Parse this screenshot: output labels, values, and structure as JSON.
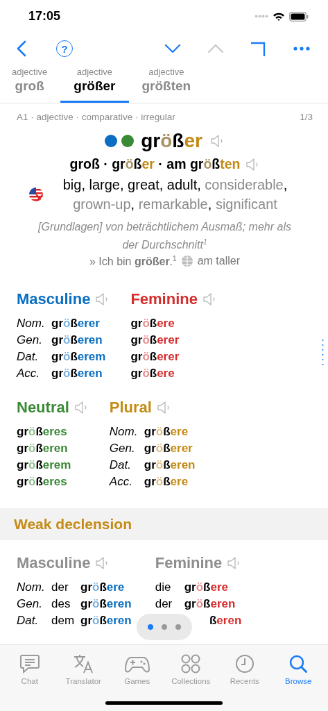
{
  "status_bar": {
    "time": "17:05"
  },
  "nav": {
    "buttons": [
      {
        "kind": "back",
        "disabled": false
      },
      {
        "kind": "help",
        "label": "?",
        "disabled": false
      },
      {
        "kind": "down",
        "disabled": false
      },
      {
        "kind": "up",
        "disabled": true
      },
      {
        "kind": "corner",
        "disabled": false
      },
      {
        "kind": "more",
        "disabled": false
      }
    ]
  },
  "word_tabs": [
    {
      "caption": "adjective",
      "word": "groß",
      "selected": false
    },
    {
      "caption": "adjective",
      "word": "größer",
      "selected": true
    },
    {
      "caption": "adjective",
      "word": "größten",
      "selected": false
    }
  ],
  "entry": {
    "meta": "A1 · adjective · comparative · irregular",
    "position": "1/3",
    "gender_dots": [
      {
        "color": "#0a6fc2"
      },
      {
        "color": "#3a8a35"
      }
    ],
    "headword": [
      "gr",
      "ö",
      "ß",
      "er"
    ],
    "forms": {
      "separator": "·",
      "words": [
        [
          "groß"
        ],
        [
          "gr",
          "ö",
          "ß",
          "er"
        ],
        [
          "am gr",
          "ö",
          "ß",
          "ten"
        ]
      ]
    },
    "translations": [
      {
        "text": "big",
        "primary": true,
        "sep": ","
      },
      {
        "text": "large",
        "primary": true,
        "sep": ","
      },
      {
        "text": "great",
        "primary": true,
        "sep": ","
      },
      {
        "text": "adult",
        "primary": true,
        "sep": ","
      },
      {
        "text": "considerable",
        "primary": false,
        "sep": ","
      },
      {
        "text": "grown-up",
        "primary": false,
        "sep": ","
      },
      {
        "text": "remarkable",
        "primary": false,
        "sep": ","
      },
      {
        "text": "significant",
        "primary": false
      }
    ],
    "definition": "[Grundlagen] von beträchtlichem Ausmaß; mehr als der Durchschnitt$^{1}$",
    "example": "» Ich bin **größer**.$^{1}$",
    "example_translation": "am taller"
  },
  "strong_declension": [
    {
      "title": "Masculine",
      "color": "#0a6fc2",
      "rows": [
        {
          "case": "Nom.",
          "form": [
            "gr",
            "ö",
            "ß",
            "erer"
          ]
        },
        {
          "case": "Gen.",
          "form": [
            "gr",
            "ö",
            "ß",
            "eren"
          ]
        },
        {
          "case": "Dat.",
          "form": [
            "gr",
            "ö",
            "ß",
            "erem"
          ]
        },
        {
          "case": "Acc.",
          "form": [
            "gr",
            "ö",
            "ß",
            "eren"
          ]
        }
      ]
    },
    {
      "title": "Feminine",
      "color": "#d62d2d",
      "rows": [
        {
          "form": [
            "gr",
            "ö",
            "ß",
            "ere"
          ]
        },
        {
          "form": [
            "gr",
            "ö",
            "ß",
            "erer"
          ]
        },
        {
          "form": [
            "gr",
            "ö",
            "ß",
            "erer"
          ]
        },
        {
          "form": [
            "gr",
            "ö",
            "ß",
            "ere"
          ]
        }
      ]
    },
    {
      "title": "Neutral",
      "color": "#3a8a35",
      "rows": [
        {
          "form": [
            "gr",
            "ö",
            "ß",
            "eres"
          ]
        },
        {
          "form": [
            "gr",
            "ö",
            "ß",
            "eren"
          ]
        },
        {
          "form": [
            "gr",
            "ö",
            "ß",
            "erem"
          ]
        },
        {
          "form": [
            "gr",
            "ö",
            "ß",
            "eres"
          ]
        }
      ]
    },
    {
      "title": "Plural",
      "color": "#c48a14",
      "rows": [
        {
          "case": "Nom.",
          "form": [
            "gr",
            "ö",
            "ß",
            "ere"
          ]
        },
        {
          "case": "Gen.",
          "form": [
            "gr",
            "ö",
            "ß",
            "erer"
          ]
        },
        {
          "case": "Dat.",
          "form": [
            "gr",
            "ö",
            "ß",
            "eren"
          ]
        },
        {
          "case": "Acc.",
          "form": [
            "gr",
            "ö",
            "ß",
            "ere"
          ]
        }
      ]
    }
  ],
  "weak_declension": {
    "title": "Weak declension",
    "sections": [
      {
        "title": "Masculine",
        "color": "#0a6fc2",
        "rows": [
          {
            "case": "Nom.",
            "article": "der",
            "form": [
              "gr",
              "ö",
              "ß",
              "ere"
            ]
          },
          {
            "case": "Gen.",
            "article": "des",
            "form": [
              "gr",
              "ö",
              "ß",
              "eren"
            ]
          },
          {
            "case": "Dat.",
            "article": "dem",
            "form": [
              "gr",
              "ö",
              "ß",
              "eren"
            ]
          }
        ]
      },
      {
        "title": "Feminine",
        "color": "#d62d2d",
        "rows": [
          {
            "article": "die",
            "form": [
              "gr",
              "ö",
              "ß",
              "ere"
            ]
          },
          {
            "article": "der",
            "form": [
              "gr",
              "ö",
              "ß",
              "eren"
            ]
          },
          {
            "visible_form": [
              "ß",
              "eren"
            ]
          }
        ]
      }
    ]
  },
  "page_dots": [
    {
      "selected": true
    },
    {
      "selected": false
    },
    {
      "selected": false
    }
  ],
  "tab_bar": [
    {
      "kind": "chat",
      "label": "Chat",
      "selected": false
    },
    {
      "kind": "translator",
      "label": "Translator",
      "selected": false
    },
    {
      "kind": "games",
      "label": "Games",
      "selected": false
    },
    {
      "kind": "collections",
      "label": "Collections",
      "selected": false
    },
    {
      "kind": "recents",
      "label": "Recents",
      "selected": false
    },
    {
      "kind": "browse",
      "label": "Browse",
      "selected": true
    }
  ]
}
